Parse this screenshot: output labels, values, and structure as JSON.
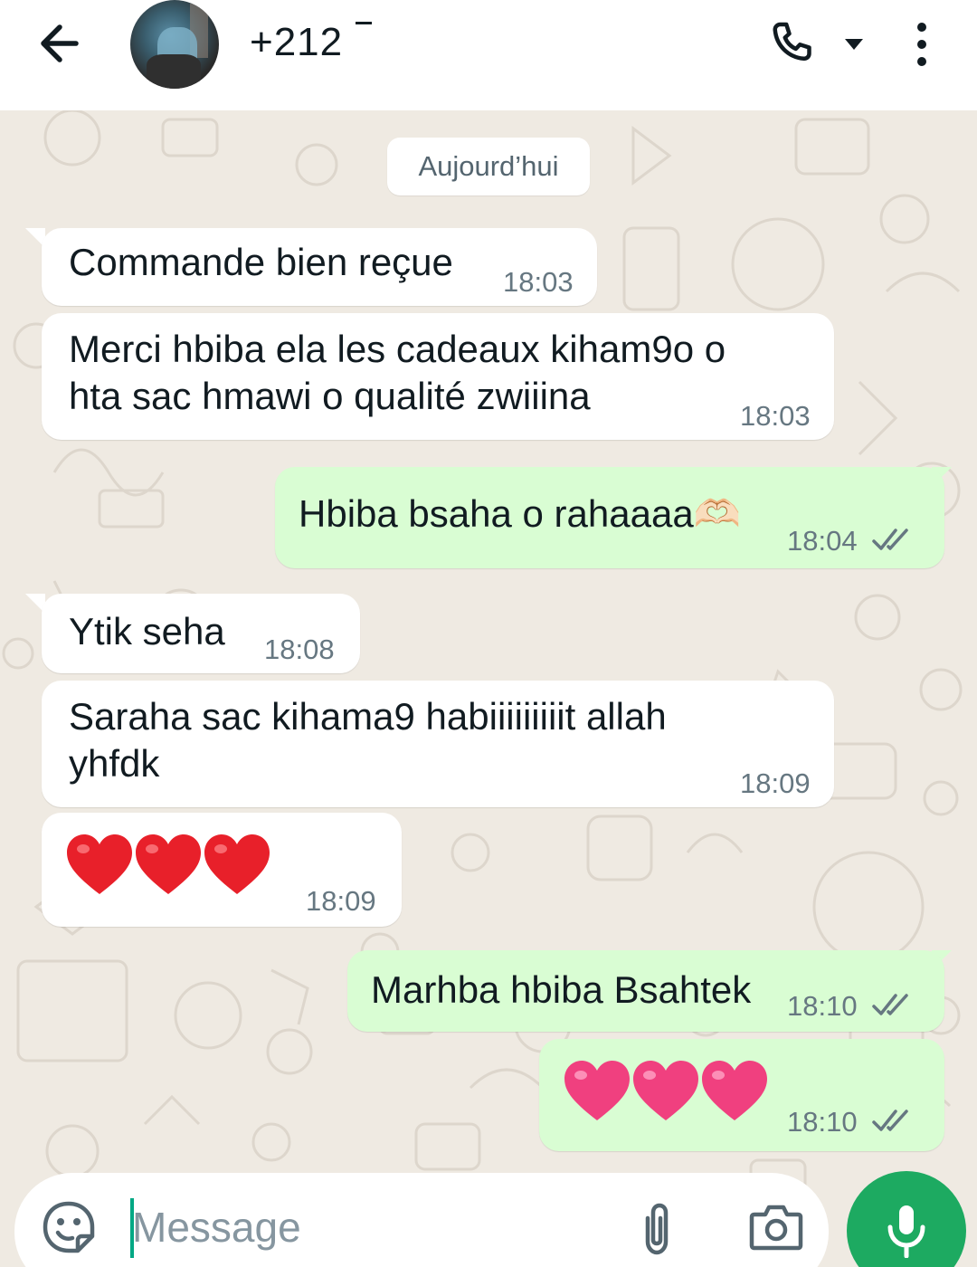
{
  "header": {
    "contact_name": "+212",
    "icons": [
      "arrow-left-icon",
      "avatar",
      "phone-icon",
      "caret-down-icon",
      "more-vert-icon"
    ]
  },
  "chat": {
    "date_label": "Aujourd’hui",
    "messages": [
      {
        "direction": "in",
        "lines": [
          "Commande bien reçue"
        ],
        "time": "18:03"
      },
      {
        "direction": "in",
        "lines": [
          "Merci hbiba ela les cadeaux kiham9o o",
          "hta sac hmawi o qualité zwiiina"
        ],
        "time": "18:03"
      },
      {
        "direction": "out",
        "lines": [
          "Hbiba bsaha o rahaaaa🫶🏻"
        ],
        "time": "18:04",
        "status": "read"
      },
      {
        "direction": "in",
        "lines": [
          "Ytik seha"
        ],
        "time": "18:08"
      },
      {
        "direction": "in",
        "lines": [
          "Saraha sac kihama9 habiiiiiiiiit allah",
          "yhfdk"
        ],
        "time": "18:09"
      },
      {
        "direction": "in",
        "lines": [
          "❤️❤️❤️"
        ],
        "time": "18:09"
      },
      {
        "direction": "out",
        "lines": [
          "Marhba hbiba Bsahtek"
        ],
        "time": "18:10",
        "status": "read"
      },
      {
        "direction": "out",
        "lines": [
          "🩷🩷🩷"
        ],
        "time": "18:10",
        "status": "read"
      }
    ]
  },
  "composer": {
    "placeholder": "Message",
    "icons": [
      "sticker-icon",
      "paperclip-icon",
      "camera-icon",
      "mic-icon"
    ]
  },
  "colors": {
    "incoming_bubble": "#ffffff",
    "outgoing_bubble": "#d9fdd3",
    "wallpaper": "#efeae2",
    "read_ticks": "#667781",
    "mic_button": "#1daa61",
    "red_heart": "#e8202a",
    "pink_heart": "#f0407f"
  }
}
